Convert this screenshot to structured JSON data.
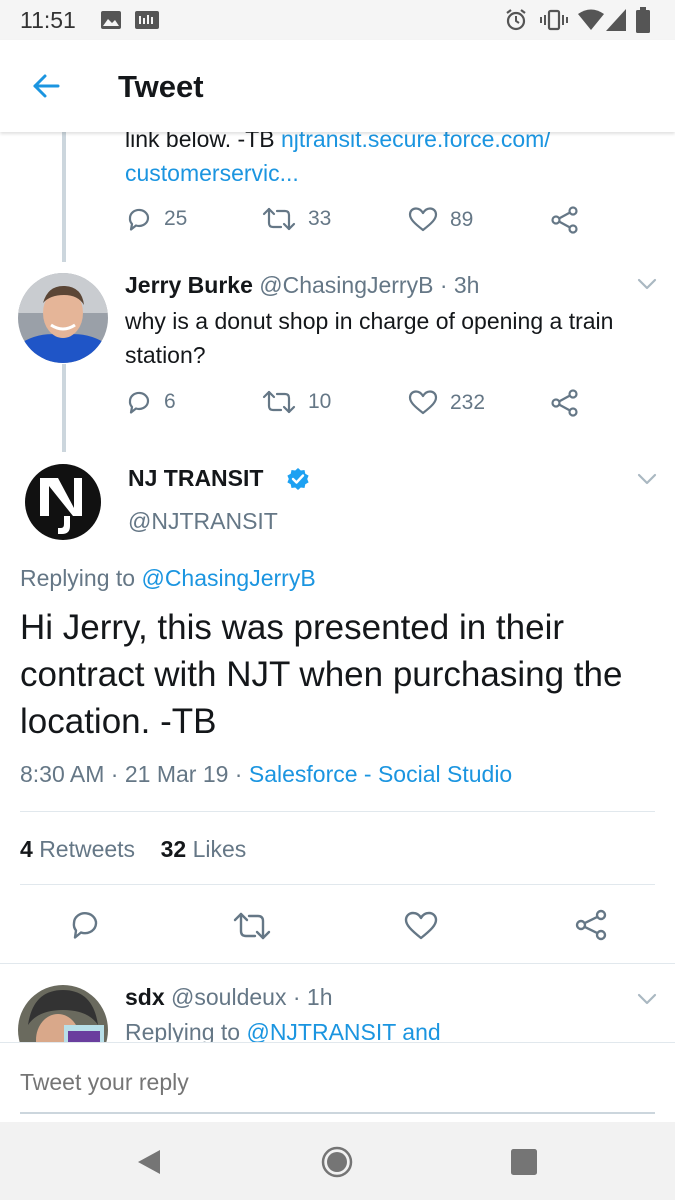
{
  "status_bar": {
    "time": "11:51"
  },
  "header": {
    "title": "Tweet"
  },
  "prev_tweet": {
    "text_line1": "link below. -TB ",
    "link_line1": "njtransit.secure.force.com/",
    "link_line2": "customerservic...",
    "replies": "25",
    "retweets": "33",
    "likes": "89"
  },
  "reply_tweet": {
    "name": "Jerry Burke",
    "handle": "@ChasingJerryB",
    "time": "3h",
    "text": "why is a donut shop in charge of opening a train station?",
    "replies": "6",
    "retweets": "10",
    "likes": "232"
  },
  "main_tweet": {
    "name": "NJ TRANSIT",
    "handle": "@NJTRANSIT",
    "replying_prefix": "Replying to ",
    "replying_to": "@ChasingJerryB",
    "text": "Hi Jerry, this was presented in their contract with NJT when purchasing the location. -TB",
    "time": "8:30 AM",
    "date": "21 Mar 19",
    "source": "Salesforce - Social Studio",
    "retweet_count": "4",
    "retweet_label": "Retweets",
    "like_count": "32",
    "like_label": "Likes"
  },
  "next_tweet": {
    "name": "sdx",
    "handle": "@souldeux",
    "time": "1h",
    "replying_prefix": "Replying to ",
    "replying_to": "@NJTRANSIT and"
  },
  "reply_bar": {
    "placeholder": "Tweet your reply"
  },
  "colors": {
    "accent": "#1b95e0",
    "muted": "#657786",
    "verified": "#1da1f2"
  },
  "icons": [
    "back-arrow-icon",
    "reply-icon",
    "retweet-icon",
    "like-icon",
    "share-icon",
    "chevron-down-icon",
    "verified-icon",
    "nav-back-icon",
    "nav-home-icon",
    "nav-recents-icon"
  ]
}
